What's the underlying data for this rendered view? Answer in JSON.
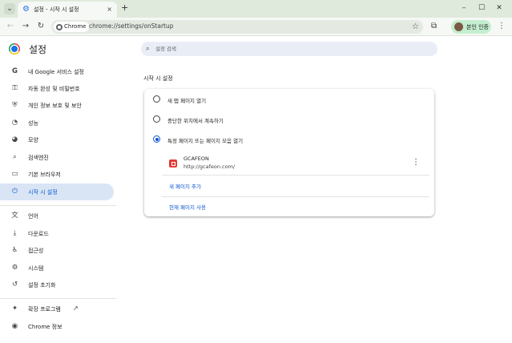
{
  "window": {
    "tab_title": "설정 - 시작 시 설정",
    "tab_close": "×",
    "tab_search_icon": "chevron-down-icon",
    "new_tab": "+",
    "minimize": "–",
    "maximize": "☐",
    "close": "✕"
  },
  "toolbar": {
    "back": "←",
    "forward": "→",
    "reload": "↻",
    "chip_label": "Chrome",
    "url": "chrome://settings/onStartup",
    "star": "☆",
    "extensions": "⧉",
    "profile_label": "본인 인증",
    "menu": "⋮"
  },
  "page": {
    "title": "설정",
    "search_placeholder": "설정 검색"
  },
  "sidebar": {
    "items": [
      {
        "label": "내 Google 서비스 설정",
        "icon": "G"
      },
      {
        "label": "자동 완성 및 비밀번호",
        "icon": "⚿"
      },
      {
        "label": "개인 정보 보호 및 보안",
        "icon": "⛨"
      },
      {
        "label": "성능",
        "icon": "◔"
      },
      {
        "label": "모양",
        "icon": "◕"
      },
      {
        "label": "검색엔진",
        "icon": "⌕"
      },
      {
        "label": "기본 브라우저",
        "icon": "▭"
      },
      {
        "label": "시작 시 설정",
        "icon": "⏻"
      },
      {
        "label": "언어",
        "icon": "文"
      },
      {
        "label": "다운로드",
        "icon": "⤓"
      },
      {
        "label": "접근성",
        "icon": "♿"
      },
      {
        "label": "시스템",
        "icon": "⚙"
      },
      {
        "label": "설정 초기화",
        "icon": "↺"
      },
      {
        "label": "확장 프로그램",
        "icon": "✦"
      },
      {
        "label": "Chrome 정보",
        "icon": "◉"
      }
    ],
    "active_index": 7,
    "external_link_icon": "↗"
  },
  "startup": {
    "section_title": "시작 시 설정",
    "options": [
      {
        "label": "새 탭 페이지 열기",
        "checked": false
      },
      {
        "label": "중단한 위치에서 계속하기",
        "checked": false
      },
      {
        "label": "특정 페이지 또는 페이지 모음 열기",
        "checked": true
      }
    ],
    "site": {
      "name": "GCAFEON",
      "url": "http://gcafeon.com/",
      "menu": "⋮"
    },
    "add_page": "새 페이지 추가",
    "use_current": "현재 페이지 사용"
  },
  "colors": {
    "accent": "#0b57d0",
    "active_nav_bg": "#d9e5f5",
    "tabstrip": "#dfe9dc",
    "profile_chip": "#c4eed0"
  }
}
